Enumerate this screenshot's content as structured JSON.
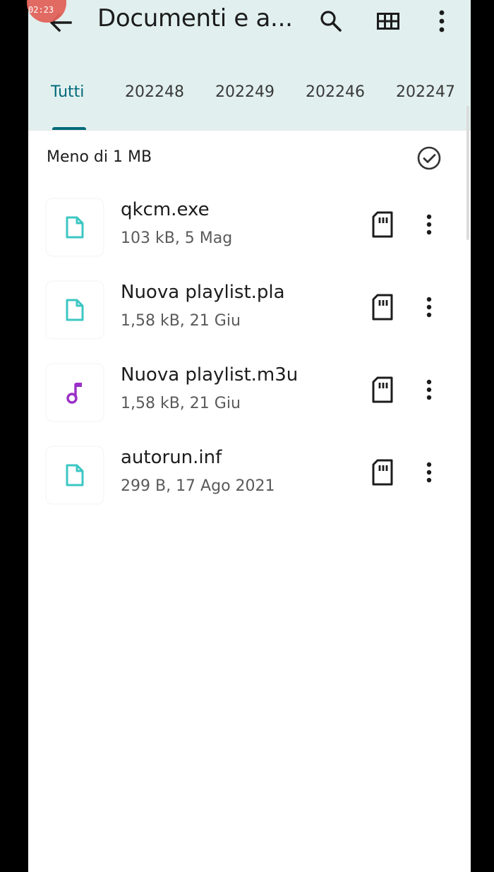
{
  "overlay": {
    "record_time": "02:23"
  },
  "appbar": {
    "title": "Documenti e a...",
    "icons": [
      "back-arrow-icon",
      "search-icon",
      "grid-view-icon",
      "more-vert-icon"
    ]
  },
  "tabs": [
    "Tutti",
    "202248",
    "202249",
    "202246",
    "202247"
  ],
  "active_tab": "Tutti",
  "section": {
    "title": "Meno di 1 MB"
  },
  "files": [
    {
      "name": "qkcm.exe",
      "meta": "103 kB, 5 Mag",
      "icon": "file-icon"
    },
    {
      "name": "Nuova playlist.pla",
      "meta": "1,58 kB, 21 Giu",
      "icon": "file-icon"
    },
    {
      "name": "Nuova playlist.m3u",
      "meta": "1,58 kB, 21 Giu",
      "icon": "music-note-icon"
    },
    {
      "name": "autorun.inf",
      "meta": "299 B, 17 Ago 2021",
      "icon": "file-icon"
    }
  ],
  "colors": {
    "appbar_bg": "#e1f0ee",
    "accent": "#00697a",
    "file_icon": "#3cc7c3",
    "music_icon": "#9b30c7"
  }
}
